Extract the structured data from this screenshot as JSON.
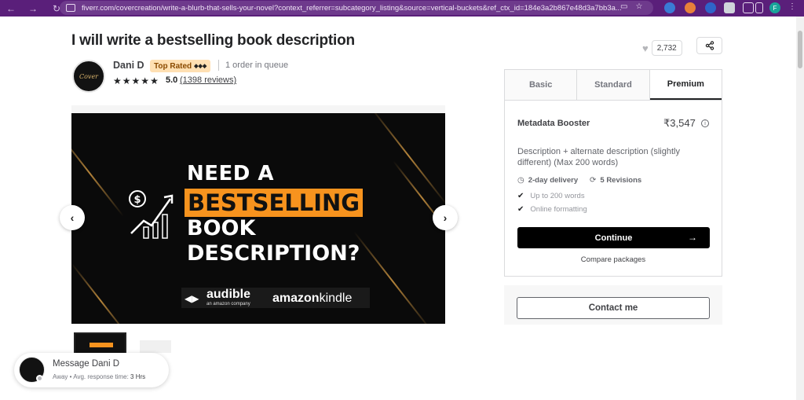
{
  "browser": {
    "url": "fiverr.com/covercreation/write-a-blurb-that-sells-your-novel?context_referrer=subcategory_listing&source=vertical-buckets&ref_ctx_id=184e3a2b867e48d3a7bb3a...",
    "profile_initial": "F"
  },
  "gig": {
    "title": "I will write a bestselling book description"
  },
  "seller": {
    "name": "Dani D",
    "badge": "Top Rated",
    "queue": "1 order in queue",
    "rating": "5.0",
    "reviews": "(1398 reviews)",
    "stars": 5
  },
  "actions": {
    "favorites_count": "2,732"
  },
  "gallery": {
    "headline_1": "NEED A",
    "headline_2": "BESTSELLING",
    "headline_3": "BOOK",
    "headline_4": "DESCRIPTION?",
    "audible": "audible",
    "audible_sub": "an amazon company",
    "amazon": "amazon",
    "kindle": "kindle"
  },
  "packages": {
    "tabs": [
      "Basic",
      "Standard",
      "Premium"
    ],
    "active_tab": "Premium",
    "name": "Metadata Booster",
    "price": "₹3,547",
    "description": "Description + alternate description (slightly different) (Max 200 words)",
    "delivery": "2-day delivery",
    "revisions": "5 Revisions",
    "features": [
      "Up to 200 words",
      "Online formatting"
    ],
    "continue_label": "Continue",
    "compare_label": "Compare packages"
  },
  "contact": {
    "label": "Contact me"
  },
  "message_popup": {
    "title": "Message Dani D",
    "status": "Away",
    "response_label": "Avg. response time:",
    "response_time": "3 Hrs"
  }
}
